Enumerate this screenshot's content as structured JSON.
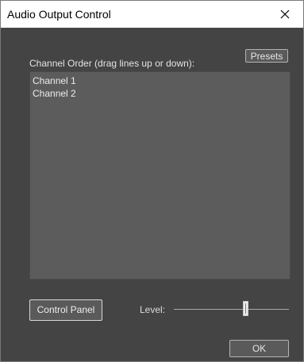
{
  "window": {
    "title": "Audio Output Control",
    "close_icon": "close-icon"
  },
  "channel_order": {
    "label": "Channel Order (drag lines up or down):",
    "items": [
      "Channel 1",
      "Channel 2"
    ]
  },
  "buttons": {
    "presets": "Presets",
    "control_panel": "Control Panel",
    "ok": "OK"
  },
  "level": {
    "label": "Level:",
    "value_fraction": 0.6
  },
  "colors": {
    "window_bg": "#444444",
    "list_bg": "#5c5c5c",
    "titlebar_bg": "#ffffff"
  }
}
